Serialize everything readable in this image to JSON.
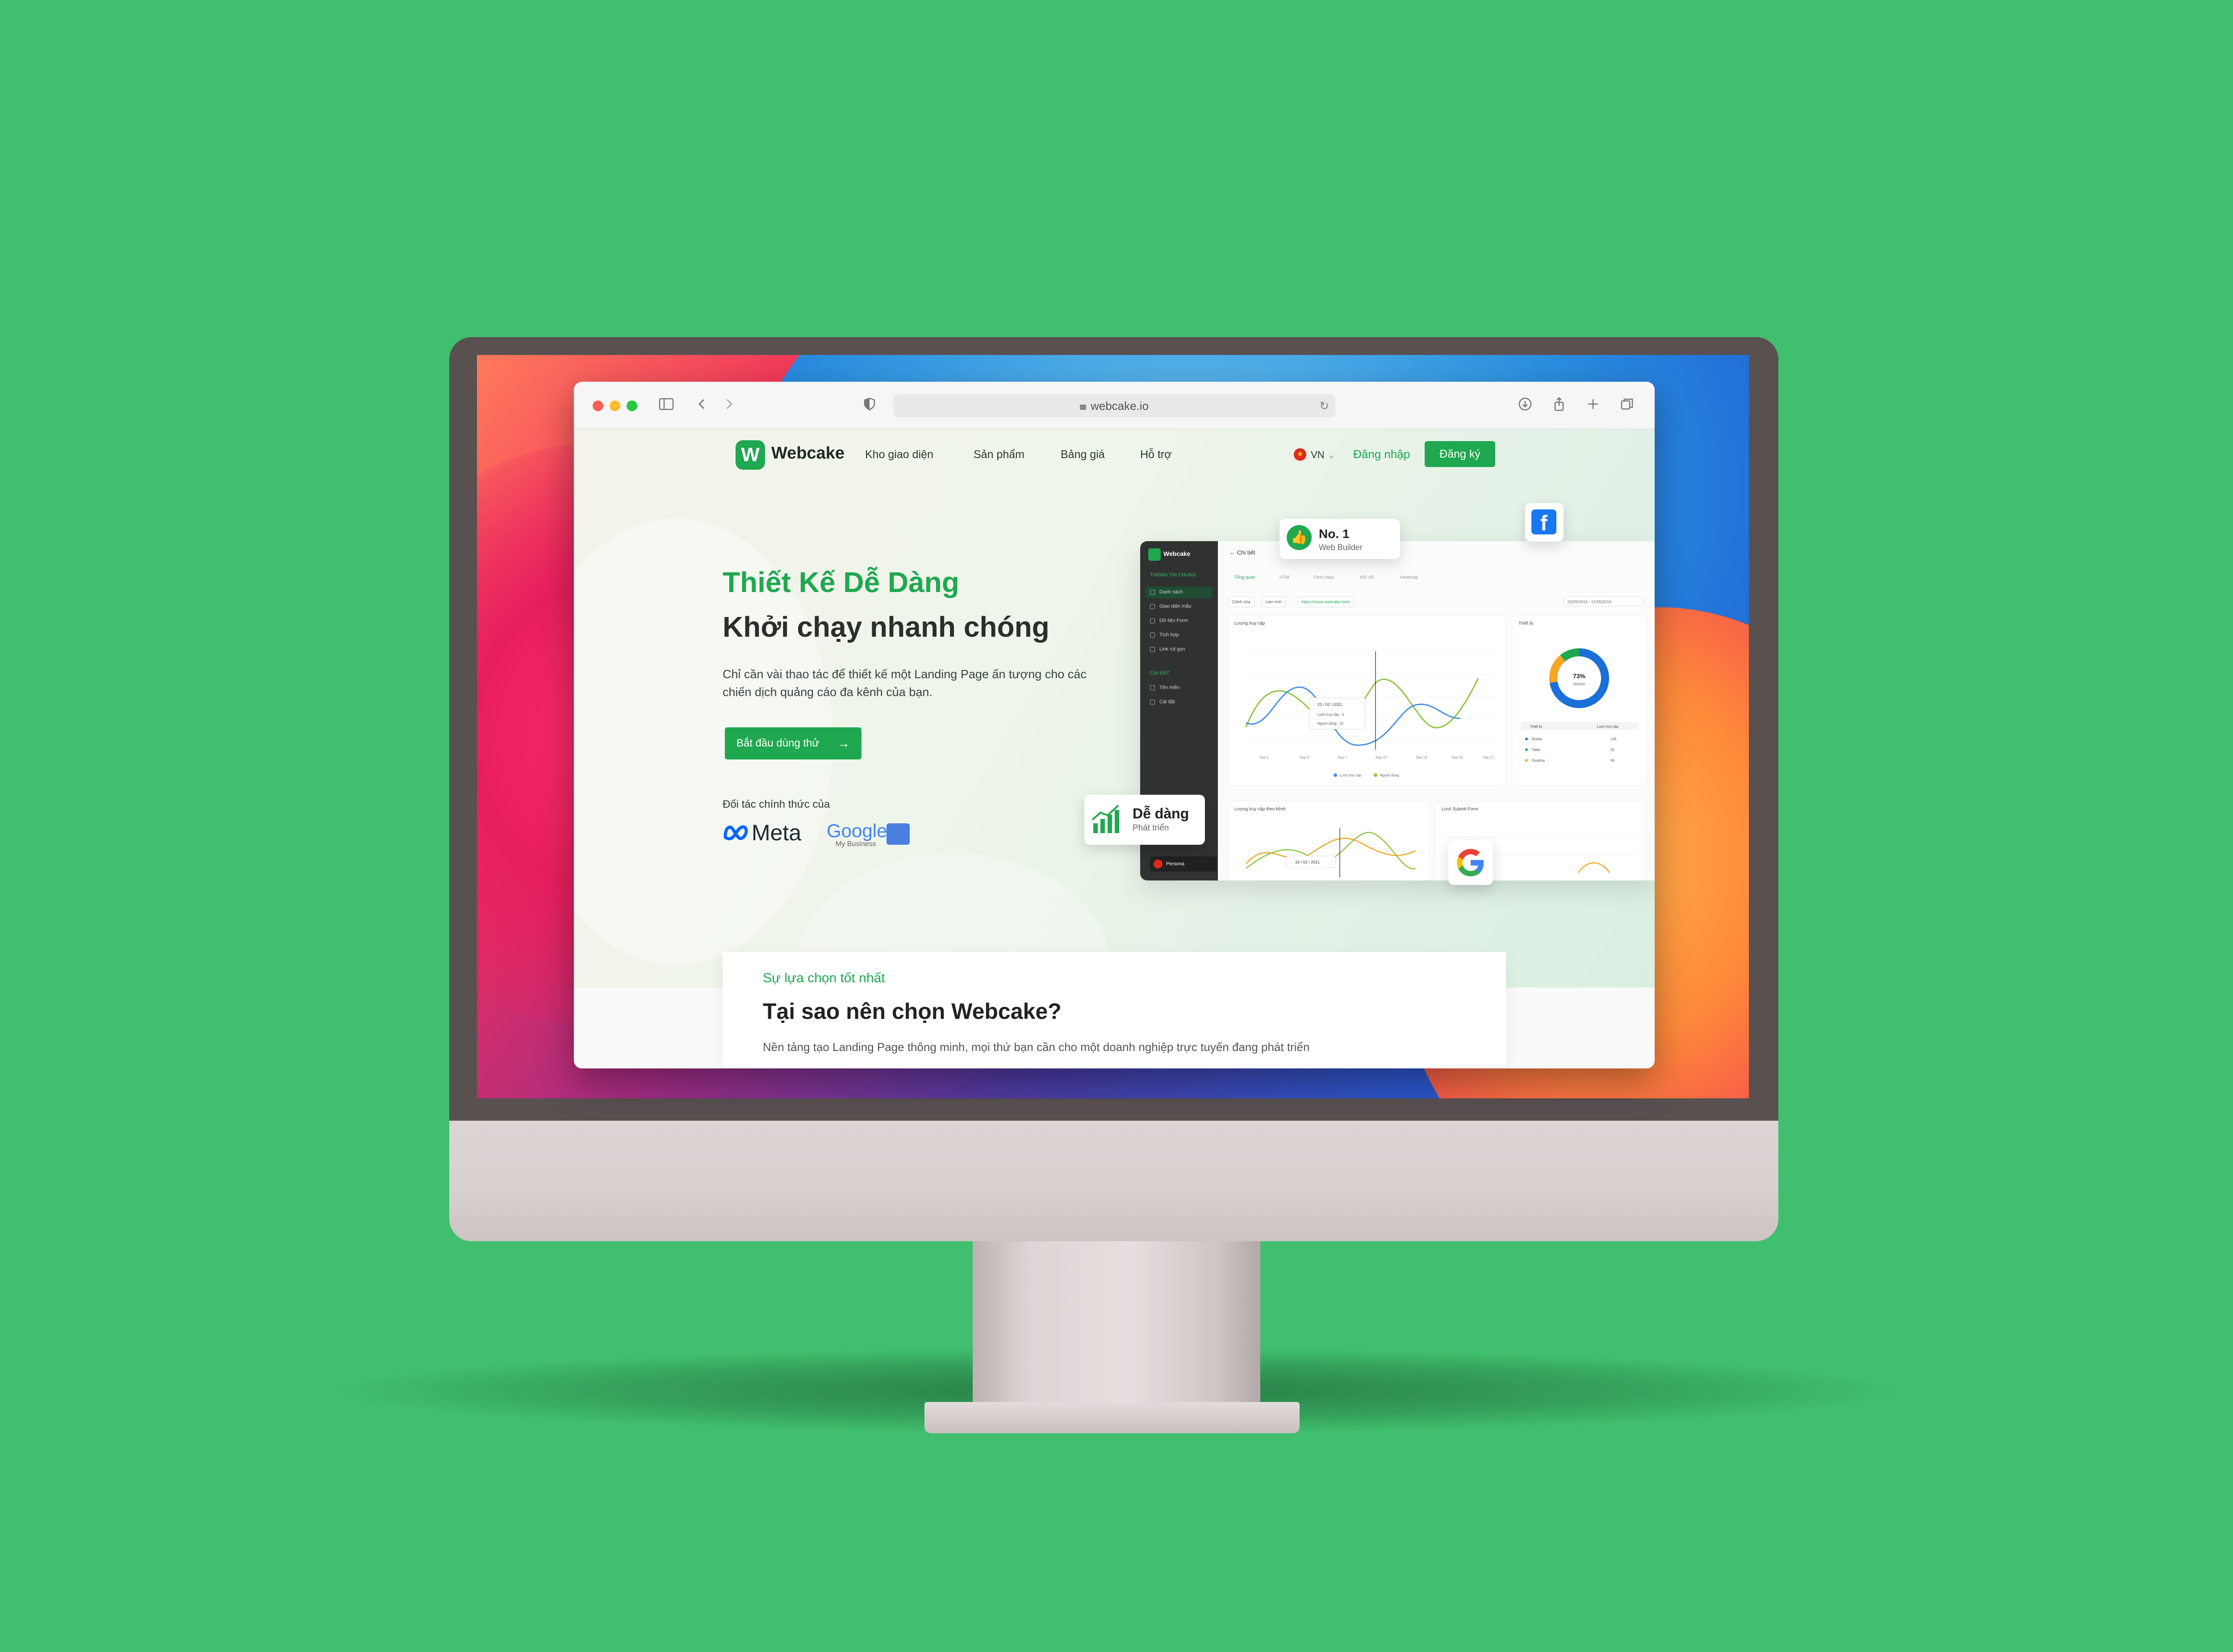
{
  "browser": {
    "url": "webcake.io"
  },
  "nav": {
    "brand": "Webcake",
    "logo_letter": "W",
    "items": [
      "Kho giao diện",
      "Sản phẩm",
      "Bảng giá",
      "Hỗ trợ"
    ],
    "language": "VN",
    "login": "Đăng nhập",
    "signup": "Đăng ký"
  },
  "hero": {
    "title_green": "Thiết Kế Dễ Dàng",
    "title_dark": "Khởi chạy nhanh chóng",
    "description": "Chỉ cần vài thao tác để thiết kế một Landing Page ấn tượng cho các chiến dịch quảng cáo đa kênh của bạn.",
    "cta": "Bắt đầu dùng thử",
    "partners_label": "Đối tác chính thức của",
    "partner_meta": "Meta",
    "partner_google": "Google",
    "partner_google_sub": "My Business"
  },
  "badges": {
    "no1_title": "No. 1",
    "no1_sub": "Web Builder",
    "easy_title": "Dễ dàng",
    "easy_sub": "Phát triển"
  },
  "dashboard": {
    "brand": "Webcake",
    "back_label": "Chi tiết",
    "sidebar_section1": "THÔNG TIN CHUNG",
    "sidebar_items1": [
      "Danh sách",
      "Giao diện mẫu",
      "Dữ liệu Form",
      "Tích hợp",
      "Link rút gọn"
    ],
    "sidebar_section2": "CÀI ĐẶT",
    "sidebar_items2": [
      "Tên miền",
      "Cài đặt"
    ],
    "user_name": "Persona",
    "tabs": [
      "Tổng quan",
      "UTM",
      "Form data",
      "Kết nối",
      "Heatmap"
    ],
    "buttons": [
      "Chỉnh sửa",
      "Làm mới"
    ],
    "link": "https://home.webcake.io/vn",
    "date_range": "02/05/2019 - 21/05/2019",
    "card1_title": "Lượng truy cập",
    "card1_tooltip_date": "21 / 02 / 2021",
    "card1_tooltip_row1": "Lượt truy cập : 3",
    "card1_tooltip_row2": "Người dùng : 15",
    "card1_x": [
      "Sep 1",
      "Sep 4",
      "Sep 7",
      "Sep 10",
      "Sep 13",
      "Sep 16",
      "Sep 17"
    ],
    "card1_legend": [
      "Lượt truy cập",
      "Người dùng"
    ],
    "card2_title": "Thiết bị",
    "donut_value": "73%",
    "donut_label": "Mobile",
    "device_headers": [
      "Thiết bị",
      "Lượt truy cập"
    ],
    "device_rows": [
      [
        "Mobile",
        "126"
      ],
      [
        "Table",
        "32"
      ],
      [
        "Desktop",
        "46"
      ]
    ],
    "card3_title": "Lượng truy cập theo kênh",
    "card3_tooltip": "16 / 02 / 2021",
    "card4_title": "Lượt Submit Form"
  },
  "section": {
    "kicker": "Sự lựa chọn tốt nhất",
    "title": "Tại sao nên chọn Webcake?",
    "description": "Nền tảng tạo Landing Page thông minh, mọi thứ bạn cần cho một doanh nghiệp trực tuyến đang phát triển"
  },
  "colors": {
    "brand_green": "#1fa84f",
    "background_green": "#40bf6e"
  }
}
